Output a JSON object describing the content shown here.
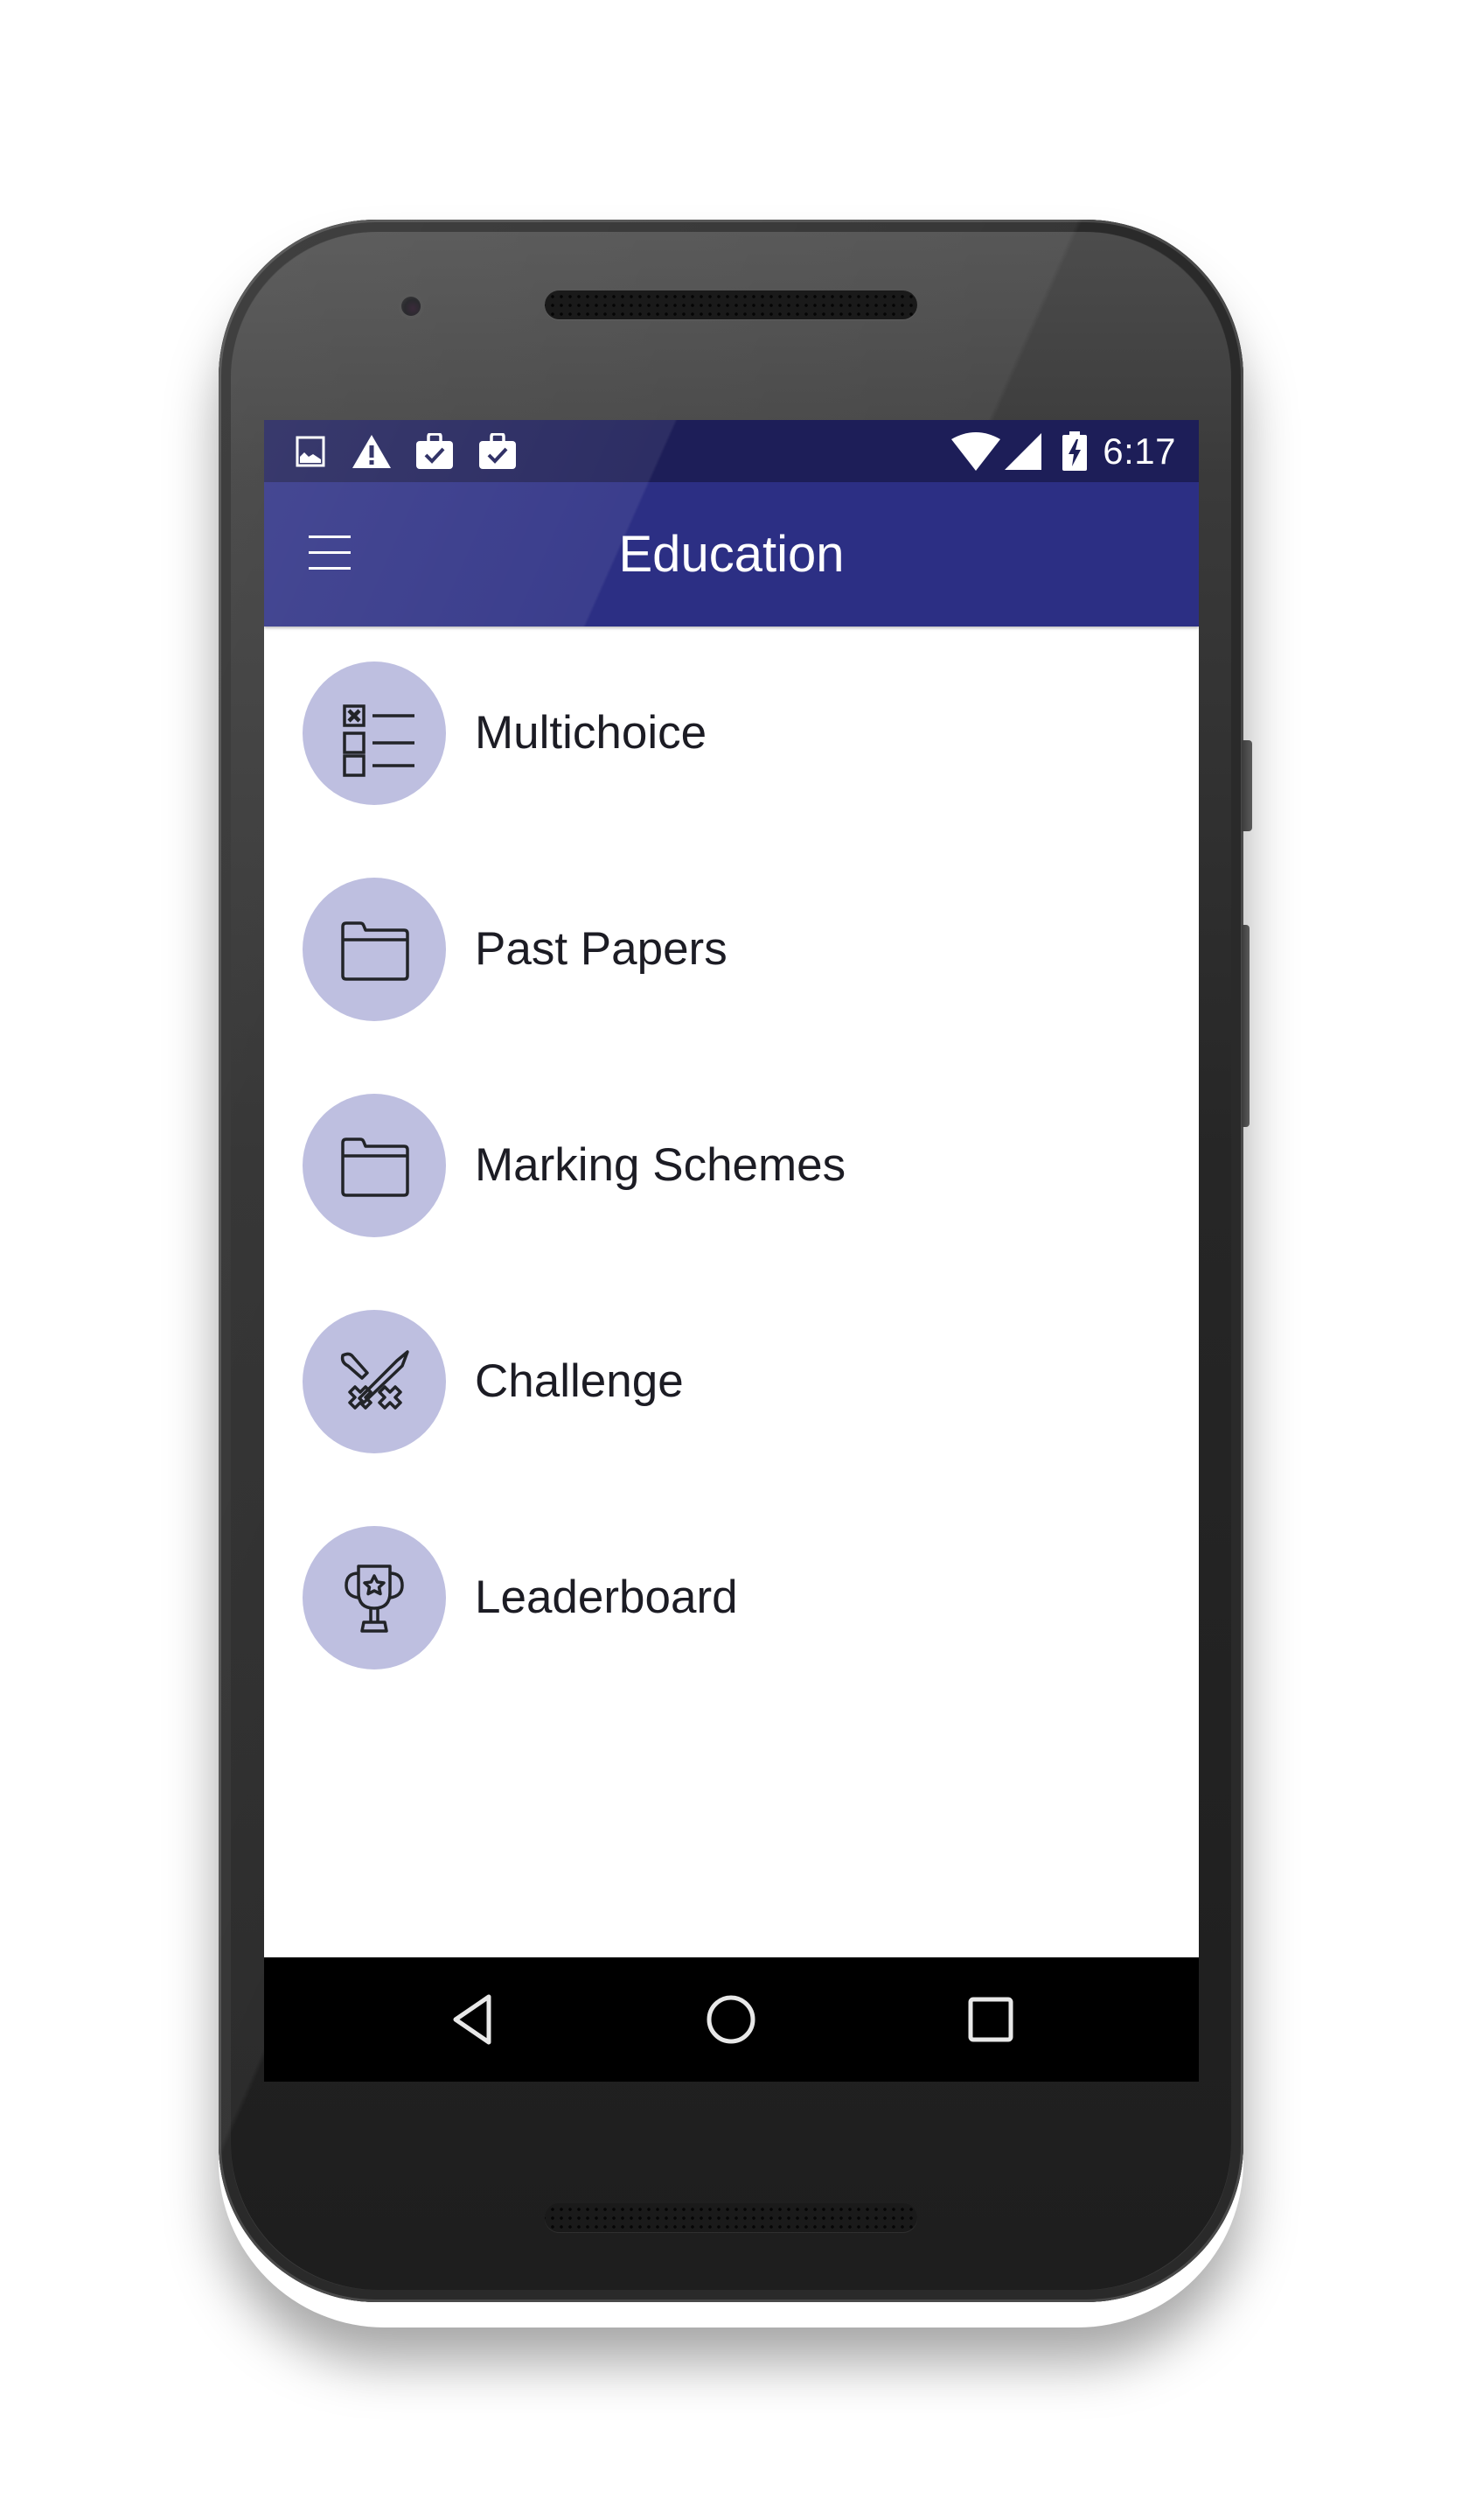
{
  "status_bar": {
    "left_icons": [
      "image-icon",
      "warning-icon",
      "work-briefcase-check-icon",
      "work-briefcase-check-icon"
    ],
    "right_icons": [
      "wifi-icon",
      "cell-signal-icon",
      "battery-charging-icon"
    ],
    "time": "6:17"
  },
  "app_bar": {
    "menu_icon": "hamburger-menu-icon",
    "title": "Education"
  },
  "menu": {
    "items": [
      {
        "label": "Multichoice",
        "icon": "checklist-icon"
      },
      {
        "label": "Past Papers",
        "icon": "folder-icon"
      },
      {
        "label": "Marking Schemes",
        "icon": "folder-icon"
      },
      {
        "label": "Challenge",
        "icon": "crossed-swords-icon"
      },
      {
        "label": "Leaderboard",
        "icon": "trophy-icon"
      }
    ]
  },
  "nav_bar": {
    "buttons": [
      "back",
      "home",
      "recents"
    ]
  },
  "colors": {
    "status_bar": "#1d1e58",
    "app_bar": "#2c2f84",
    "icon_circle": "#bebfe0",
    "label_text": "#1c1c24",
    "nav_bar": "#000000"
  }
}
